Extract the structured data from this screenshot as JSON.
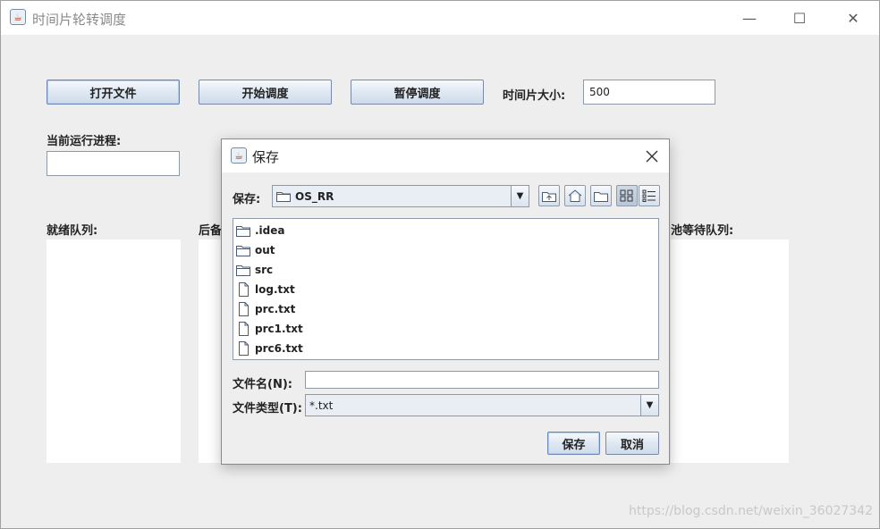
{
  "window": {
    "title": "时间片轮转调度",
    "minimize": "—",
    "maximize": "☐",
    "close": "✕"
  },
  "toolbar": {
    "open_label": "打开文件",
    "start_label": "开始调度",
    "pause_label": "暂停调度"
  },
  "time_slice": {
    "label": "时间片大小:",
    "value": "500"
  },
  "current_process": {
    "label": "当前运行进程:",
    "value": ""
  },
  "queues": {
    "ready_label": "就绪队列:",
    "backup_label": "后备",
    "io_wait_label": "I/O等待队列:",
    "io_wait_visible": "池等待队列:"
  },
  "dialog": {
    "title": "保存",
    "save_in_label": "保存:",
    "save_in_value": "OS_RR",
    "files": [
      {
        "name": ".idea",
        "type": "folder"
      },
      {
        "name": "out",
        "type": "folder"
      },
      {
        "name": "src",
        "type": "folder"
      },
      {
        "name": "log.txt",
        "type": "file"
      },
      {
        "name": "prc.txt",
        "type": "file"
      },
      {
        "name": "prc1.txt",
        "type": "file"
      },
      {
        "name": "prc6.txt",
        "type": "file"
      }
    ],
    "filename_label": "文件名(N):",
    "filename_value": "",
    "filetype_label": "文件类型(T):",
    "filetype_value": "*.txt",
    "save_button": "保存",
    "cancel_button": "取消"
  },
  "watermark": "https://blog.csdn.net/weixin_36027342"
}
